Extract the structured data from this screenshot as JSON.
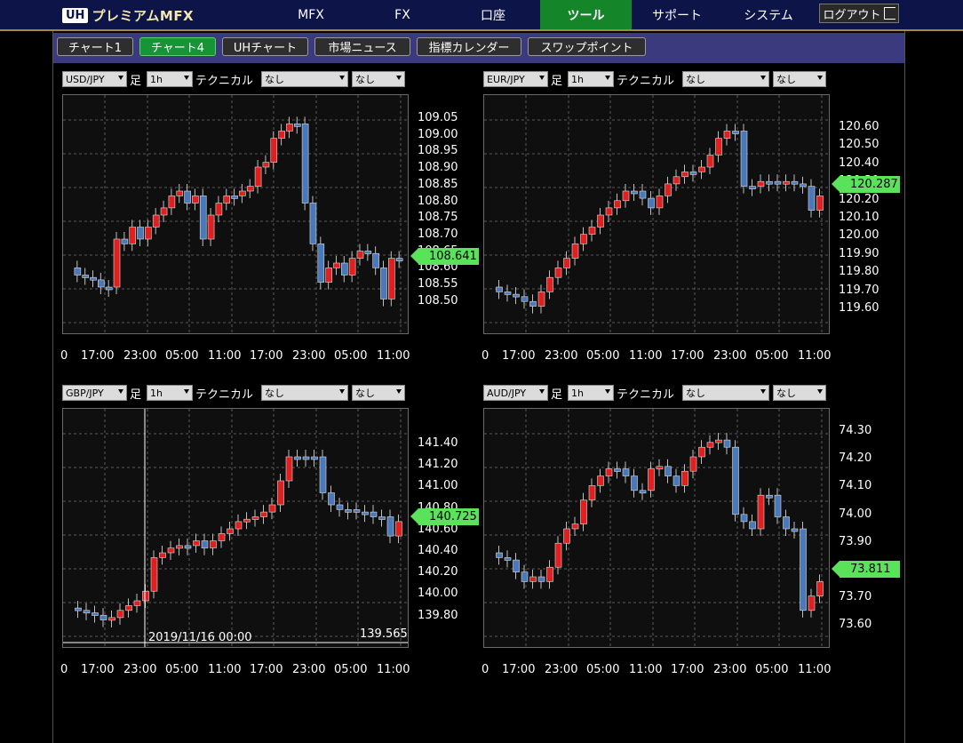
{
  "header": {
    "logo_badge": "UH",
    "logo_text": "プレミアムMFX",
    "nav": [
      "MFX",
      "FX",
      "口座",
      "ツール",
      "サポート",
      "システム"
    ],
    "active_nav": "ツール",
    "logout": "ログアウト"
  },
  "subtabs": [
    "チャート1",
    "チャート4",
    "UHチャート",
    "市場ニュース",
    "指標カレンダー",
    "スワップポイント"
  ],
  "active_subtab": "チャート4",
  "labels": {
    "ashi": "足",
    "technical": "テクニカル"
  },
  "charts": [
    {
      "symbol": "USD/JPY",
      "timeframe": "1h",
      "tech1": "なし",
      "tech2": "なし",
      "last_price": "108.641",
      "yticks": [
        "109.05",
        "109.00",
        "108.95",
        "108.90",
        "108.85",
        "108.80",
        "108.75",
        "108.70",
        "108.65",
        "108.60",
        "108.55",
        "108.50"
      ],
      "xticks": [
        "0",
        "17:00",
        "23:00",
        "05:00",
        "11:00",
        "17:00",
        "23:00",
        "05:00",
        "11:00"
      ]
    },
    {
      "symbol": "EUR/JPY",
      "timeframe": "1h",
      "tech1": "なし",
      "tech2": "なし",
      "last_price": "120.287",
      "yticks": [
        "120.60",
        "120.50",
        "120.40",
        "120.30",
        "120.20",
        "120.10",
        "120.00",
        "119.90",
        "119.80",
        "119.70",
        "119.60"
      ],
      "xticks": [
        "0",
        "17:00",
        "23:00",
        "05:00",
        "11:00",
        "17:00",
        "23:00",
        "05:00",
        "11:00"
      ]
    },
    {
      "symbol": "GBP/JPY",
      "timeframe": "1h",
      "tech1": "なし",
      "tech2": "なし",
      "last_price": "140.725",
      "yticks": [
        "141.40",
        "141.20",
        "141.00",
        "140.80",
        "140.60",
        "140.40",
        "140.20",
        "140.00",
        "139.80"
      ],
      "xticks": [
        "0",
        "17:00",
        "23:00",
        "05:00",
        "11:00",
        "17:00",
        "23:00",
        "05:00",
        "11:00"
      ],
      "crosshair_time": "2019/11/16 00:00",
      "crosshair_price": "139.565"
    },
    {
      "symbol": "AUD/JPY",
      "timeframe": "1h",
      "tech1": "なし",
      "tech2": "なし",
      "last_price": "73.811",
      "yticks": [
        "74.30",
        "74.20",
        "74.10",
        "74.00",
        "73.90",
        "73.80",
        "73.70",
        "73.60"
      ],
      "xticks": [
        "0",
        "17:00",
        "23:00",
        "05:00",
        "11:00",
        "17:00",
        "23:00",
        "05:00",
        "11:00"
      ]
    }
  ],
  "colors": {
    "up": "#e02020",
    "down": "#4a78b8",
    "price_tag": "#5ae35a",
    "active_tab": "#148528",
    "subbar": "#3b3a7e",
    "topbar": "#0d1548"
  }
}
